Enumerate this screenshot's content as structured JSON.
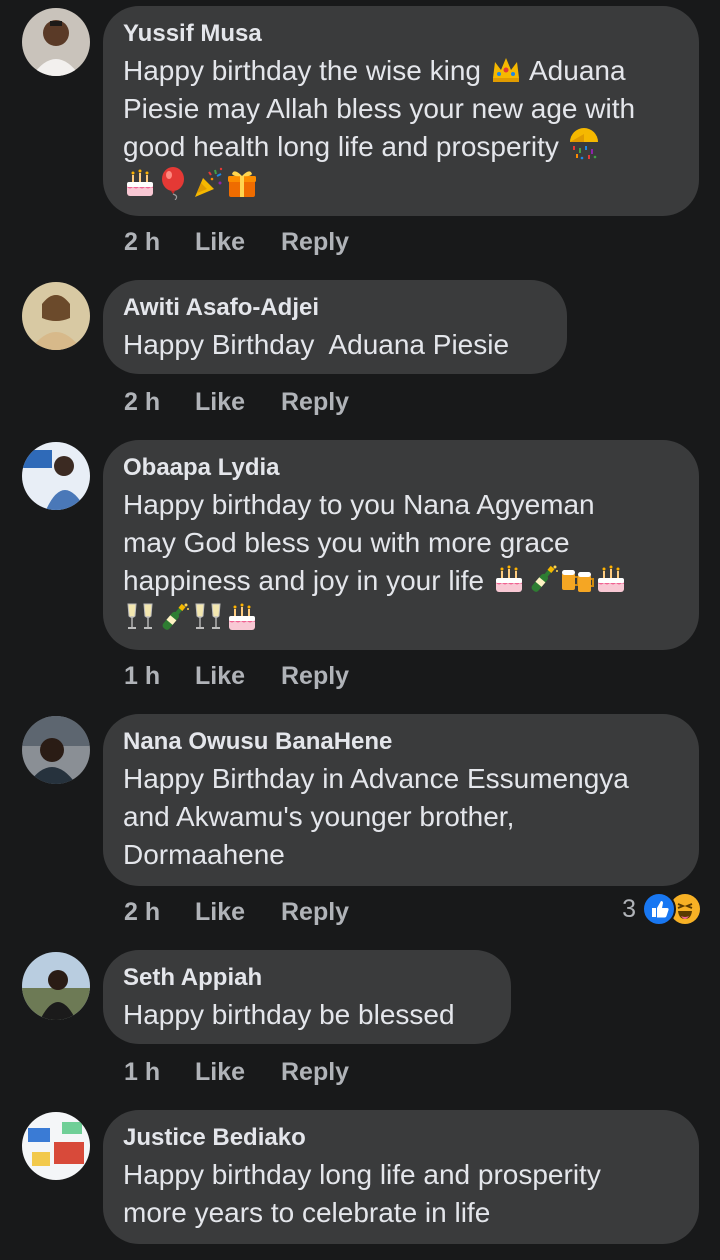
{
  "comments": [
    {
      "author": "Yussif Musa",
      "lines": [
        "Happy birthday the wise king",
        "Aduana",
        "Piesie may Allah bless your new age with",
        "good health long life and prosperity"
      ],
      "time": "2 h",
      "like": "Like",
      "reply": "Reply"
    },
    {
      "author": "Awiti Asafo-Adjei",
      "lines": [
        "Happy Birthday  Aduana Piesie"
      ],
      "time": "2 h",
      "like": "Like",
      "reply": "Reply"
    },
    {
      "author": "Obaapa Lydia",
      "lines": [
        "Happy birthday to you Nana Agyeman",
        "may God bless you with more grace",
        "happiness and joy in your life"
      ],
      "time": "1 h",
      "like": "Like",
      "reply": "Reply"
    },
    {
      "author": "Nana Owusu BanaHene",
      "lines": [
        "Happy Birthday in Advance Essumengya",
        "and Akwamu's younger brother,",
        "Dormaahene"
      ],
      "time": "2 h",
      "like": "Like",
      "reply": "Reply",
      "reaction_count": "3"
    },
    {
      "author": "Seth Appiah",
      "lines": [
        "Happy birthday be blessed"
      ],
      "time": "1 h",
      "like": "Like",
      "reply": "Reply"
    },
    {
      "author": "Justice Bediako",
      "lines": [
        "Happy birthday long life and prosperity",
        "more years to celebrate in life"
      ]
    }
  ],
  "colors": {
    "background": "#18191a",
    "bubble": "#3a3b3c",
    "text": "#e4e6eb",
    "secondary": "#b0b3b8",
    "like_blue": "#1877f2",
    "haha_yellow": "#f7b125"
  },
  "icons": {
    "crown": "crown-icon",
    "confetti": "confetti-ball-icon",
    "cake": "birthday-cake-icon",
    "balloon": "balloon-icon",
    "popper": "party-popper-icon",
    "gift": "gift-icon",
    "bottle": "champagne-bottle-icon",
    "beers": "beer-mugs-icon",
    "glasses": "clinking-glasses-icon",
    "like_reaction": "like-reaction-icon",
    "haha_reaction": "haha-reaction-icon"
  }
}
